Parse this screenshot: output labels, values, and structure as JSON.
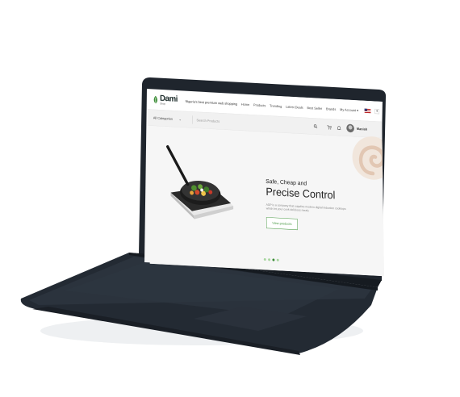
{
  "brand": {
    "name": "Dami",
    "sub": "Shop",
    "tagline": "Nigeria's best premium web shopping"
  },
  "nav": {
    "items": [
      "Home",
      "Products",
      "Trending",
      "Latest Deals",
      "Best Seller",
      "Brands"
    ],
    "account": "My Account",
    "lang": "En"
  },
  "search": {
    "category": "All Categories",
    "placeholder": "Search Products"
  },
  "user": {
    "name": "Manish"
  },
  "hero": {
    "subtitle": "Safe, Cheap and",
    "title": "Precise Control",
    "description": "ADP is a company that supplies modern digital induction cooktops which let your cook delicious meals",
    "button": "View products",
    "slide_count": 4,
    "active_slide": 3
  },
  "colors": {
    "accent": "#3f8f3a",
    "laptop": "#20262f",
    "swirl": "#e8d6c8"
  },
  "icons": [
    "search-icon",
    "cart-icon",
    "bell-icon",
    "chevron-down-icon"
  ]
}
